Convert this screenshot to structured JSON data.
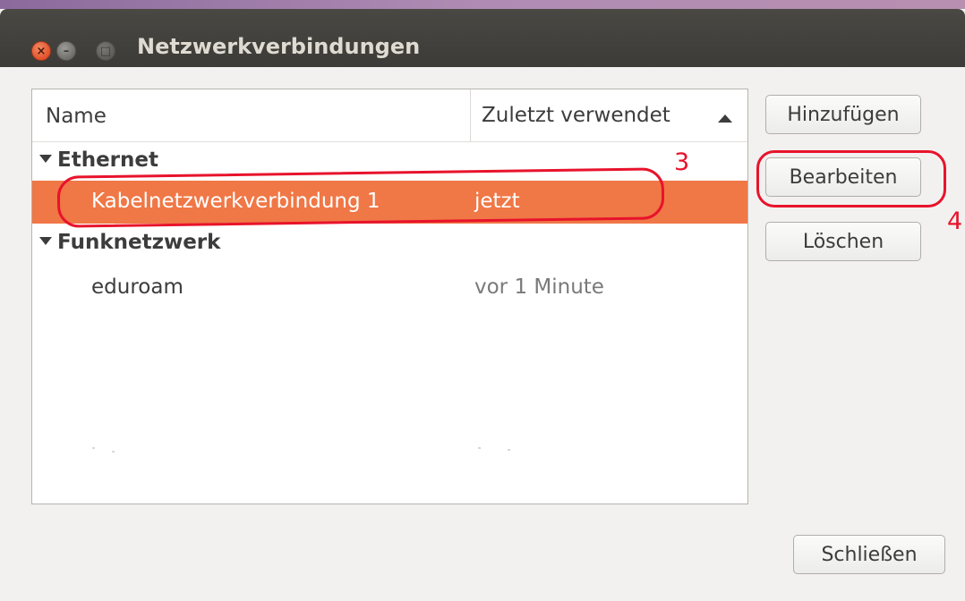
{
  "window": {
    "title": "Netzwerkverbindungen"
  },
  "titlebar_buttons": {
    "close_glyph": "×",
    "minimize_glyph": "–",
    "maximize_glyph": "□"
  },
  "connection_list": {
    "columns": [
      "Name",
      "Zuletzt verwendet"
    ],
    "sort_indicator": "ascending",
    "groups": [
      {
        "name": "Ethernet",
        "items": [
          {
            "name": "Kabelnetzwerkverbindung 1",
            "last_used": "jetzt",
            "selected": true
          }
        ]
      },
      {
        "name": "Funknetzwerk",
        "items": [
          {
            "name": "eduroam",
            "last_used": "vor 1 Minute",
            "selected": false
          }
        ]
      }
    ]
  },
  "buttons": {
    "add": "Hinzufügen",
    "edit": "Bearbeiten",
    "delete": "Löschen",
    "close": "Schließen"
  },
  "annotations": {
    "step3": "3",
    "step4": "4",
    "color": "#e8132b"
  },
  "colors": {
    "selection": "#f07746",
    "titlebar": "#3c3b37",
    "background": "#f2f1f0"
  }
}
